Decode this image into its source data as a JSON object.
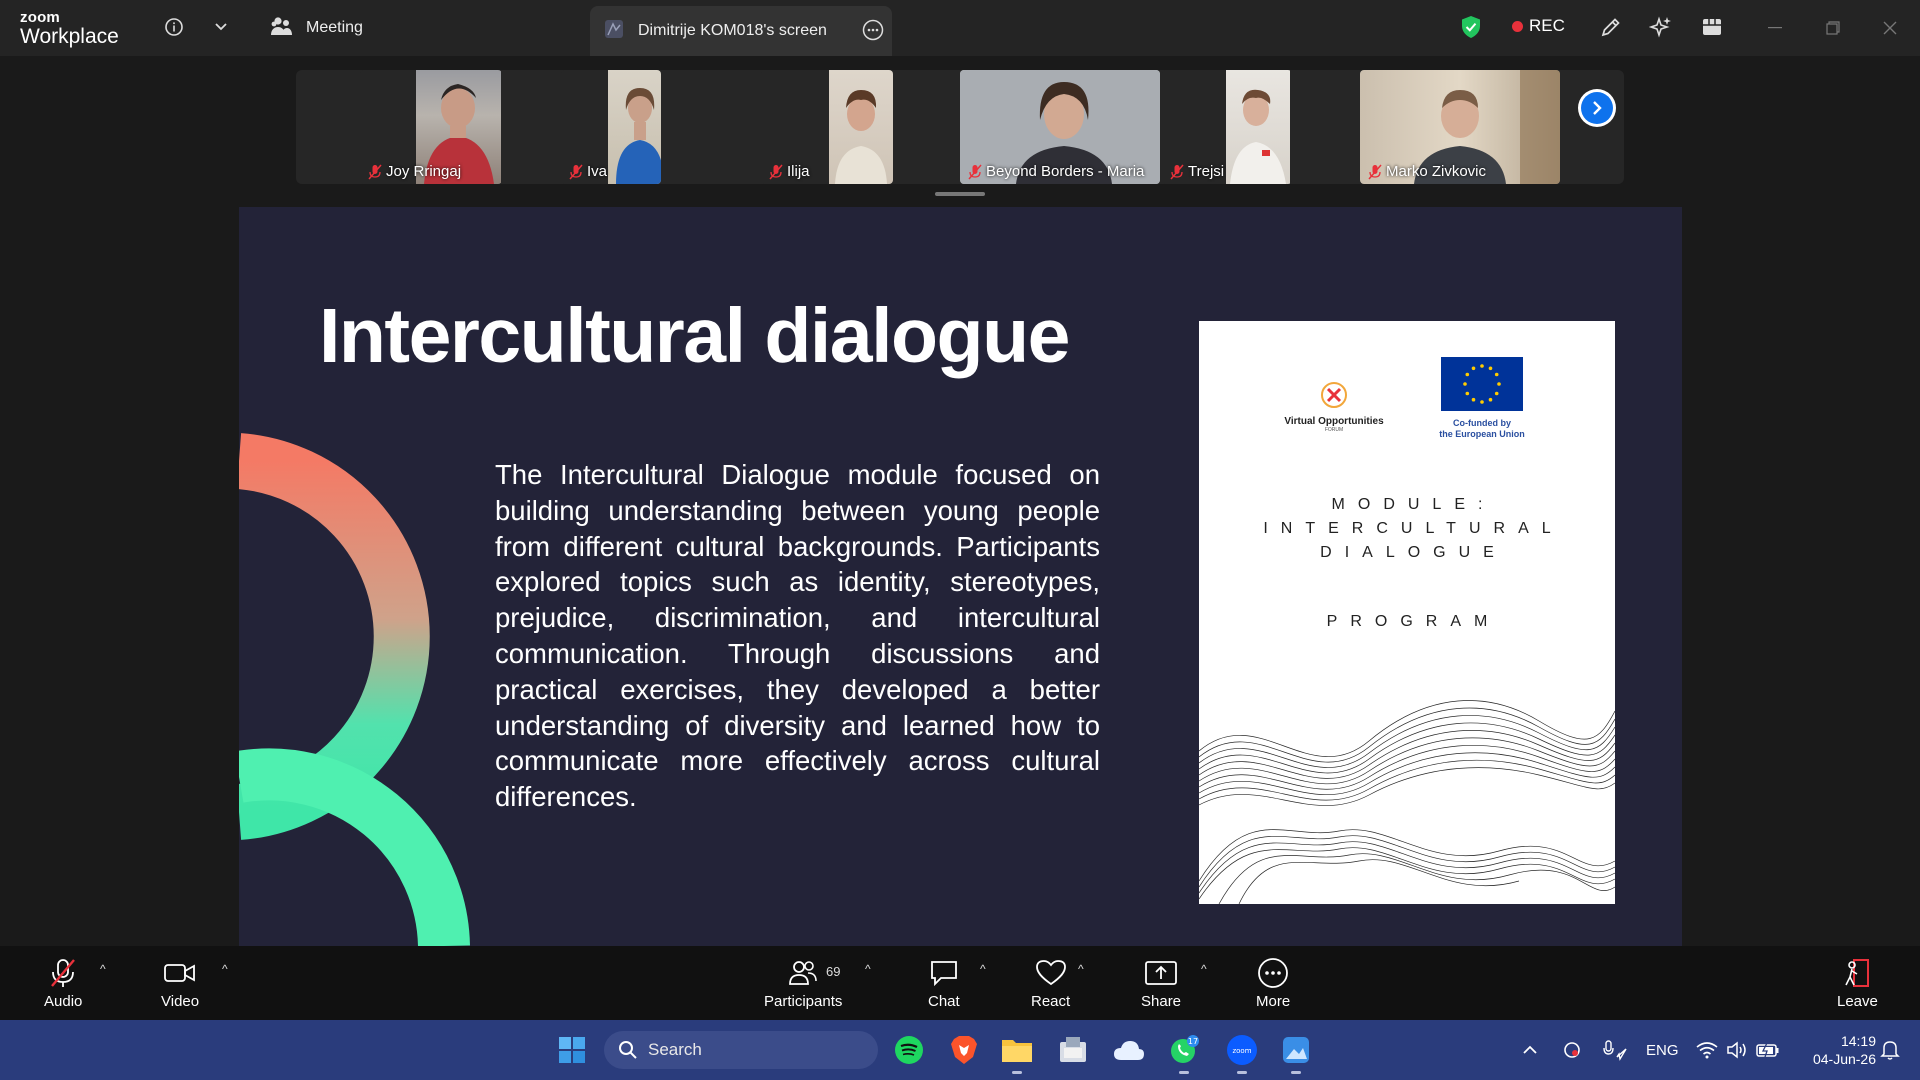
{
  "app": {
    "brand_small": "zoom",
    "brand_large": "Workplace"
  },
  "titlebar": {
    "meeting_label": "Meeting",
    "screen_tab_label": "Dimitrije KOM018's screen",
    "rec_label": "REC"
  },
  "gallery": {
    "participants": [
      {
        "name": "Joy Rringaj"
      },
      {
        "name": "Iva"
      },
      {
        "name": "Ilija"
      },
      {
        "name": "Beyond Borders - Maria"
      },
      {
        "name": "Trejsi"
      },
      {
        "name": "Marko Zivkovic"
      }
    ]
  },
  "slide": {
    "title": "Intercultural dialogue",
    "body": "The Intercultural Dialogue module focused on building understanding between young people from different cultural backgrounds. Participants explored topics such as identity, stereotypes, prejudice, discrimination, and intercultural communication. Through discussions and practical exercises, they developed a better understanding of diversity and learned how to communicate more effectively across cultural differences.",
    "booklet": {
      "org_name": "Virtual Opportunities",
      "org_sub": "FORUM",
      "eu_line1": "Co-funded by",
      "eu_line2": "the European Union",
      "module_line1": "MODULE:",
      "module_line2": "INTERCULTURAL",
      "module_line3": "DIALOGUE",
      "program": "PROGRAM"
    }
  },
  "toolbar": {
    "audio": "Audio",
    "video": "Video",
    "participants": "Participants",
    "participants_count": "69",
    "chat": "Chat",
    "react": "React",
    "share": "Share",
    "more": "More",
    "leave": "Leave"
  },
  "taskbar": {
    "search_label": "Search",
    "whatsapp_badge": "17",
    "language": "ENG",
    "time": "14:19",
    "date": "04-Jun-26"
  },
  "colors": {
    "zoom_blue": "#0e72ed",
    "rec_red": "#e8313b",
    "slide_bg": "#232338",
    "arc_coral": "#f47a65",
    "arc_mint": "#4ff0b0"
  }
}
